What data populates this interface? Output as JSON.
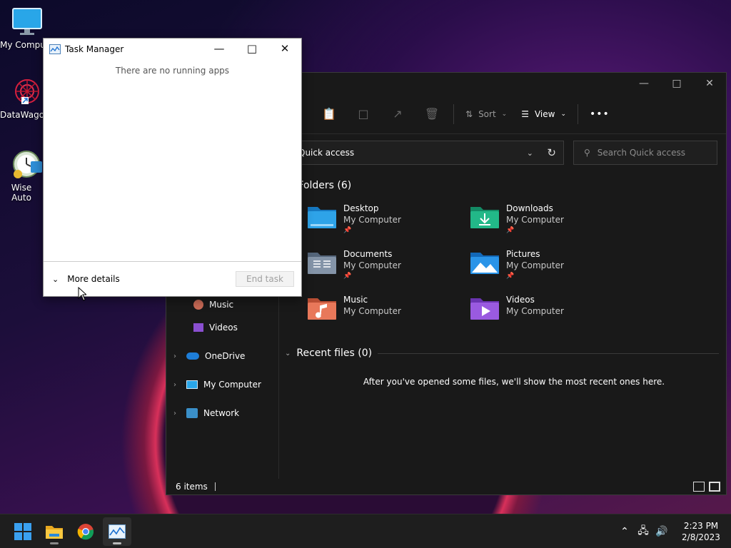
{
  "desktop": {
    "icons": [
      {
        "label": "My Computer",
        "icon": "monitor-icon"
      },
      {
        "label": "DataWagon",
        "icon": "datawagon-icon"
      },
      {
        "label": "Wise Auto Shutdown",
        "icon": "wise-shutdown-icon"
      }
    ]
  },
  "explorer": {
    "toolbar": {
      "sort_label": "Sort",
      "view_label": "View",
      "more_label": "•••"
    },
    "address": "Quick access",
    "search_placeholder": "Search Quick access",
    "nav": [
      {
        "label": "Music",
        "icon": "music-icon"
      },
      {
        "label": "Videos",
        "icon": "videos-icon"
      },
      {
        "label": "OneDrive",
        "icon": "onedrive-icon"
      },
      {
        "label": "My Computer",
        "icon": "monitor-icon"
      },
      {
        "label": "Network",
        "icon": "network-icon"
      }
    ],
    "folders_header": "Folders (6)",
    "folders": [
      {
        "name": "Desktop",
        "location": "My Computer",
        "pinned": true,
        "color": "#1e8fd8"
      },
      {
        "name": "Downloads",
        "location": "My Computer",
        "pinned": true,
        "color": "#1aa87a"
      },
      {
        "name": "Documents",
        "location": "My Computer",
        "pinned": true,
        "color": "#6f8296"
      },
      {
        "name": "Pictures",
        "location": "My Computer",
        "pinned": true,
        "color": "#1a8fe0"
      },
      {
        "name": "Music",
        "location": "My Computer",
        "pinned": false,
        "color": "#e0704e"
      },
      {
        "name": "Videos",
        "location": "My Computer",
        "pinned": false,
        "color": "#8a4fd0"
      }
    ],
    "recent_header": "Recent files (0)",
    "recent_empty": "After you've opened some files, we'll show the most recent ones here.",
    "status": "6 items"
  },
  "taskmanager": {
    "title": "Task Manager",
    "empty": "There are no running apps",
    "more_details": "More details",
    "end_task": "End task"
  },
  "taskbar": {
    "time": "2:23 PM",
    "date": "2/8/2023",
    "apps": [
      "start-icon",
      "file-explorer-icon",
      "chrome-icon",
      "task-manager-icon"
    ]
  }
}
